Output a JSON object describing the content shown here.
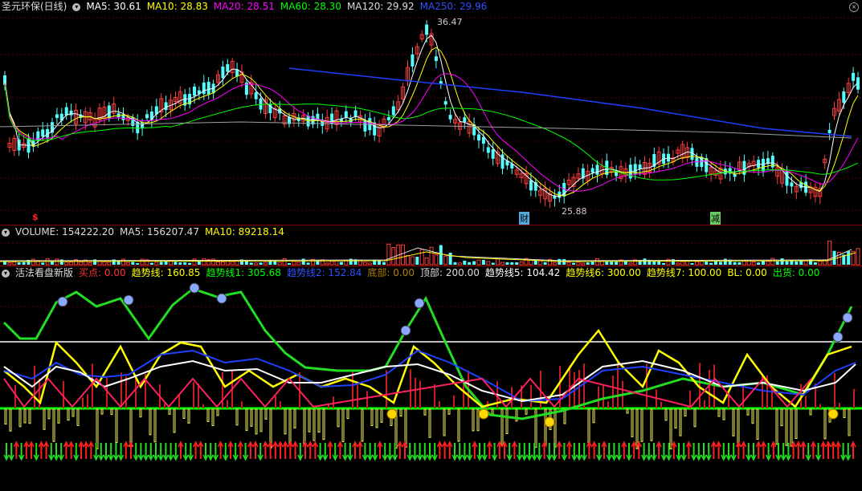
{
  "main_header": {
    "stock_name": "圣元环保(日线)",
    "ma5": "MA5: 30.61",
    "ma10": "MA10: 28.83",
    "ma20": "MA20: 28.51",
    "ma60": "MA60: 28.30",
    "ma120": "MA120: 29.92",
    "ma250": "MA250: 29.96"
  },
  "price_high_label": "36.47",
  "price_low_label": "25.88",
  "markers": {
    "s": "$",
    "cai": "财",
    "jian": "减"
  },
  "volume_header": {
    "volume": "VOLUME: 154222.20",
    "ma5": "MA5: 156207.47",
    "ma10": "MA10: 89218.14"
  },
  "indicator_header": {
    "name": "活法看盘新版",
    "buy": "买点: 0.00",
    "trend": "趋势线: 160.85",
    "trend1": "趋势线1: 305.68",
    "trend2": "趋势线2: 152.84",
    "bottom": "底部: 0.00",
    "top": "顶部: 200.00",
    "trend5": "趋势线5: 104.42",
    "trend6": "趋势线6: 300.00",
    "trend7": "趋势线7: 100.00",
    "bl": "BL: 0.00",
    "sell": "出货: 0.00"
  },
  "colors": {
    "up": "#ff3c3c",
    "down": "#54ffff",
    "ma5": "#ffffff",
    "ma10": "#ffff00",
    "ma20": "#ff00ff",
    "ma60": "#00ff00",
    "ma120": "#a0a0a0",
    "ma250": "#1f3fff"
  }
}
